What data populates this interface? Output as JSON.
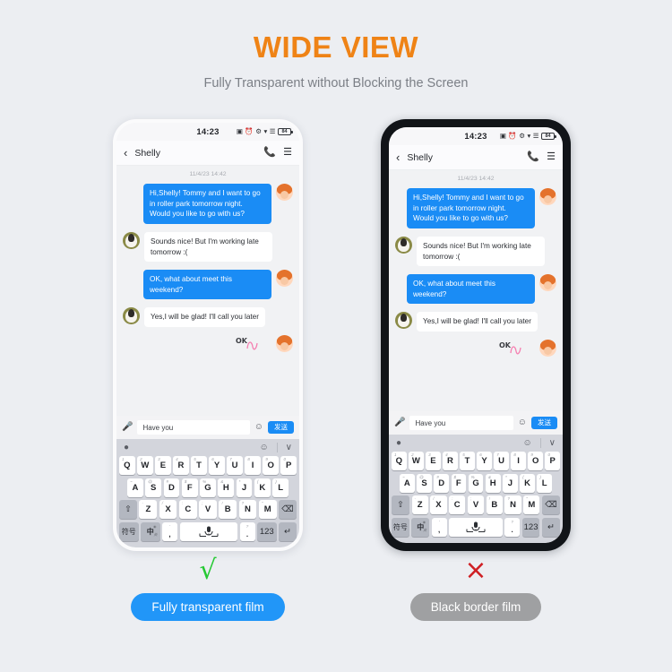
{
  "header": {
    "title": "WIDE VIEW",
    "subtitle": "Fully Transparent without Blocking the Screen",
    "title_color": "#ef8316",
    "subtitle_color": "#7b7f86"
  },
  "phone": {
    "status_bar": {
      "time": "14:23",
      "battery_level": "84",
      "icons": [
        "nfc-icon",
        "alarm-icon",
        "bluetooth-icon",
        "wifi-icon",
        "signal-icon",
        "battery-icon"
      ]
    },
    "chat_header": {
      "back_label": "‹",
      "contact_name": "Shelly",
      "call_icon": "📞",
      "menu_icon": "☰"
    },
    "chat": {
      "timestamp": "11/4/23 14:42",
      "messages": [
        {
          "side": "out",
          "avatar": "girl-avatar",
          "text": "Hi,Shelly!\nTommy and I want to go in roller park tomorrow night. Would you like to go with us?"
        },
        {
          "side": "in",
          "avatar": "dog-avatar",
          "text": "Sounds nice!\nBut I'm working late tomorrow :("
        },
        {
          "side": "out",
          "avatar": "girl-avatar",
          "text": "OK, what about meet this weekend?"
        },
        {
          "side": "in",
          "avatar": "dog-avatar",
          "text": "Yes,I will be glad!\nI'll call you later"
        }
      ],
      "sticker_text": "OK",
      "bubble_out_color": "#1a8cf5",
      "bubble_in_color": "#ffffff"
    },
    "input_bar": {
      "mic_icon": "🎤",
      "input_value": "Have you",
      "emoji_icon": "☺",
      "send_label": "发送",
      "send_color": "#1a8cf5"
    },
    "keyboard": {
      "toolbar": {
        "left_icon": "ⓘ",
        "emoji_icon": "☺",
        "collapse_icon": "∨"
      },
      "row1": [
        {
          "key": "Q",
          "sup": "1"
        },
        {
          "key": "W",
          "sup": "2"
        },
        {
          "key": "E",
          "sup": "3"
        },
        {
          "key": "R",
          "sup": "4"
        },
        {
          "key": "T",
          "sup": "5"
        },
        {
          "key": "Y",
          "sup": "6"
        },
        {
          "key": "U",
          "sup": "7"
        },
        {
          "key": "I",
          "sup": "8"
        },
        {
          "key": "O",
          "sup": "9"
        },
        {
          "key": "P",
          "sup": "0"
        }
      ],
      "row2": [
        {
          "key": "A",
          "sup": "~"
        },
        {
          "key": "S",
          "sup": "@"
        },
        {
          "key": "D",
          "sup": "#"
        },
        {
          "key": "F",
          "sup": "$"
        },
        {
          "key": "G",
          "sup": "%"
        },
        {
          "key": "H",
          "sup": "&"
        },
        {
          "key": "J",
          "sup": "*"
        },
        {
          "key": "K",
          "sup": "("
        },
        {
          "key": "L",
          "sup": ")"
        }
      ],
      "row3": [
        {
          "key": "Z",
          "sup": "-"
        },
        {
          "key": "X",
          "sup": "/"
        },
        {
          "key": "C",
          "sup": ":"
        },
        {
          "key": "V",
          "sup": ";"
        },
        {
          "key": "B",
          "sup": "!"
        },
        {
          "key": "N",
          "sup": "?"
        },
        {
          "key": "M",
          "sup": "\""
        }
      ],
      "shift_icon": "⇧",
      "backspace_icon": "⌫",
      "symbols_label": "符号",
      "lang_label": "中",
      "lang_sub": "英",
      "comma_sup": "'",
      "comma_main": ",",
      "space_icon": "🎤",
      "period_sup": "?",
      "period_main": ".",
      "numbers_label": "123",
      "enter_icon": "↵"
    }
  },
  "verdicts": {
    "left": {
      "mark": "√",
      "mark_color": "#25c933",
      "label": "Fully transparent film",
      "pill_color": "#2196f8"
    },
    "right": {
      "mark": "×",
      "mark_color": "#cf1f24",
      "label": "Black border film",
      "pill_color": "#9fa0a2"
    }
  },
  "background_color": "#eceef2"
}
